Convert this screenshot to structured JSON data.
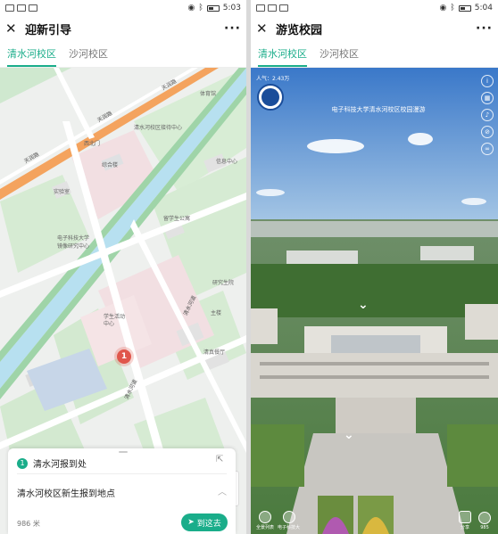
{
  "left": {
    "status": {
      "time": "5:03"
    },
    "title": "迎新引导",
    "tabs": [
      {
        "label": "清水河校区",
        "active": true
      },
      {
        "label": "沙河校区",
        "active": false
      }
    ],
    "map": {
      "road_labels": [
        "天润路",
        "天润路",
        "天润路",
        "清水河道",
        "清水河道"
      ],
      "place_labels": [
        "清水河校区接待中心",
        "西北门",
        "体育馆",
        "综合楼",
        "信息中心",
        "实验室",
        "留学生公寓",
        "电子科技大学",
        "镜像研究中心",
        "研究生院",
        "学生活动中心",
        "主楼",
        "清真餐厅"
      ],
      "marker": "1",
      "zoom_in": "+",
      "zoom_out": "−"
    },
    "sheet": {
      "num": "1",
      "name": "清水河报到处",
      "desc": "清水河校区新生报到地点",
      "distance": "986 米",
      "go_label": "到这去"
    },
    "icons": {
      "close": "close-icon",
      "more": "more-icon",
      "share": "share-icon",
      "locate": "locate-icon",
      "navigate": "navigate-arrow-icon"
    }
  },
  "right": {
    "status": {
      "time": "5:04"
    },
    "title": "游览校园",
    "tabs": [
      {
        "label": "清水河校区",
        "active": true
      },
      {
        "label": "沙河校区",
        "active": false
      }
    ],
    "pano": {
      "views": "人气：2.43万",
      "scene_title": "电子科技大学清水河校区校园漫游",
      "side_icons": [
        "info-icon",
        "grid-icon",
        "music-icon",
        "compass-icon",
        "vr-icon"
      ],
      "bottom_left": [
        {
          "label": "全景列表",
          "icon": "panorama-list-icon"
        },
        {
          "label": "电子科技大",
          "icon": "tour-icon"
        }
      ],
      "bottom_right": [
        {
          "label": "分享",
          "icon": "share-icon"
        },
        {
          "label": "985",
          "icon": "like-icon"
        }
      ]
    }
  }
}
